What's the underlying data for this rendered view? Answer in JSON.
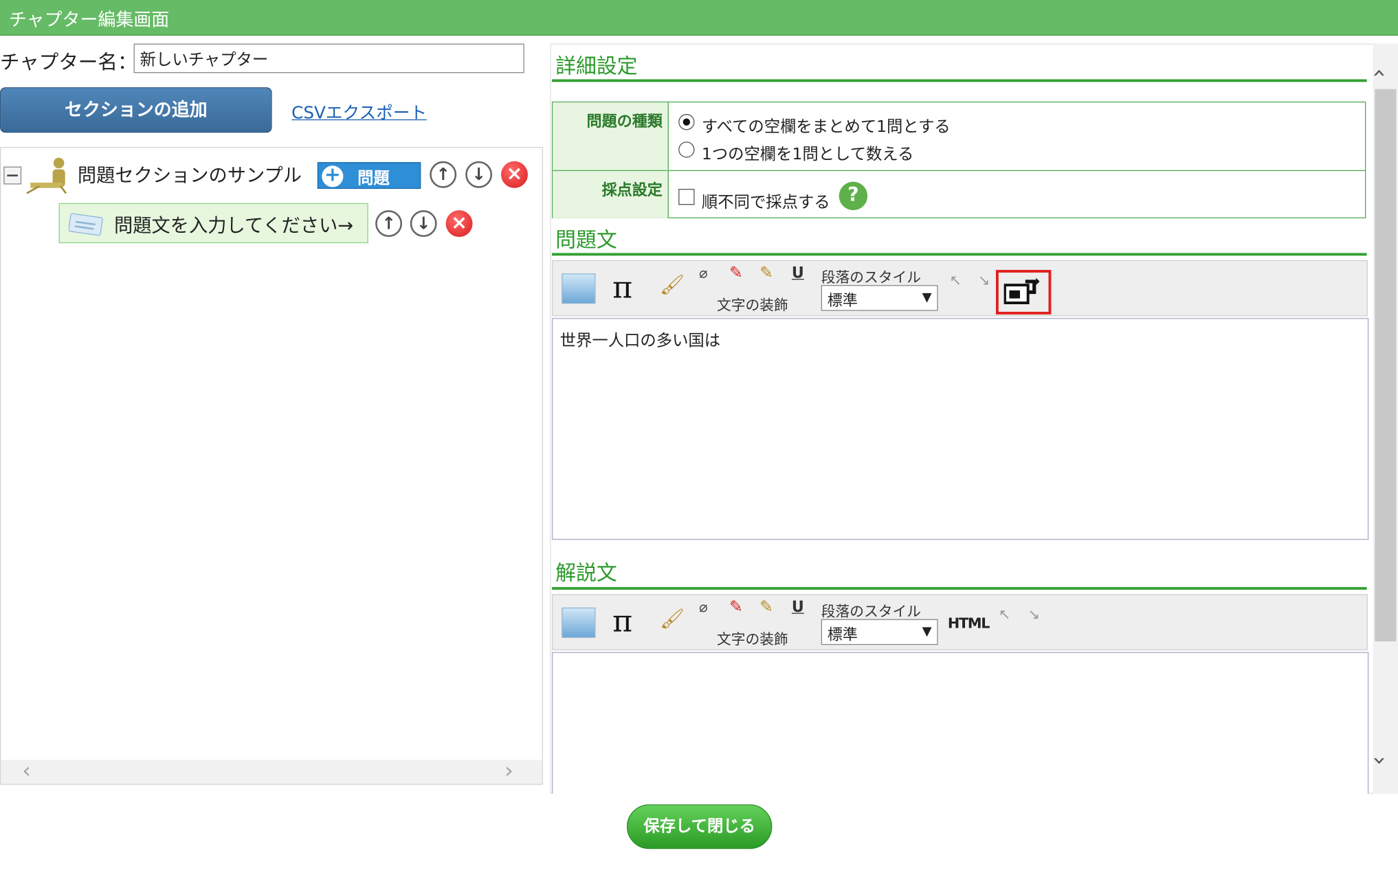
{
  "window": {
    "title": "チャプター編集画面"
  },
  "chapter": {
    "label": "チャプター名：",
    "name": "新しいチャプター"
  },
  "actions": {
    "add_section": "セクションの追加",
    "csv_export": "CSVエクスポート",
    "save_close": "保存して閉じる"
  },
  "tree": {
    "section": {
      "label": "問題セクションのサンプル",
      "add_question": "問題"
    },
    "question": {
      "label": "問題文を入力してください→"
    }
  },
  "details": {
    "heading": "詳細設定",
    "type_label": "問題の種類",
    "type_options": [
      "すべての空欄をまとめて1問とする",
      "1つの空欄を1問として数える"
    ],
    "type_selected": 0,
    "scoring_label": "採点設定",
    "scoring_option": "順不同で採点する",
    "scoring_checked": false
  },
  "question_text": {
    "heading": "問題文",
    "content": "世界一人口の多い国は",
    "toolbar": {
      "decoration": "文字の装飾",
      "para_style_label": "段落のスタイル",
      "para_style_value": "標準"
    }
  },
  "explanation": {
    "heading": "解説文",
    "content": "",
    "toolbar": {
      "decoration": "文字の装飾",
      "para_style_label": "段落のスタイル",
      "para_style_value": "標準",
      "html": "HTML"
    }
  },
  "colors": {
    "titlebar": "#66bb66",
    "heading_green": "#2a9a2a",
    "add_section_btn": "#3f75a6",
    "add_question_btn": "#2e8ed6",
    "highlight": "#e02020"
  }
}
